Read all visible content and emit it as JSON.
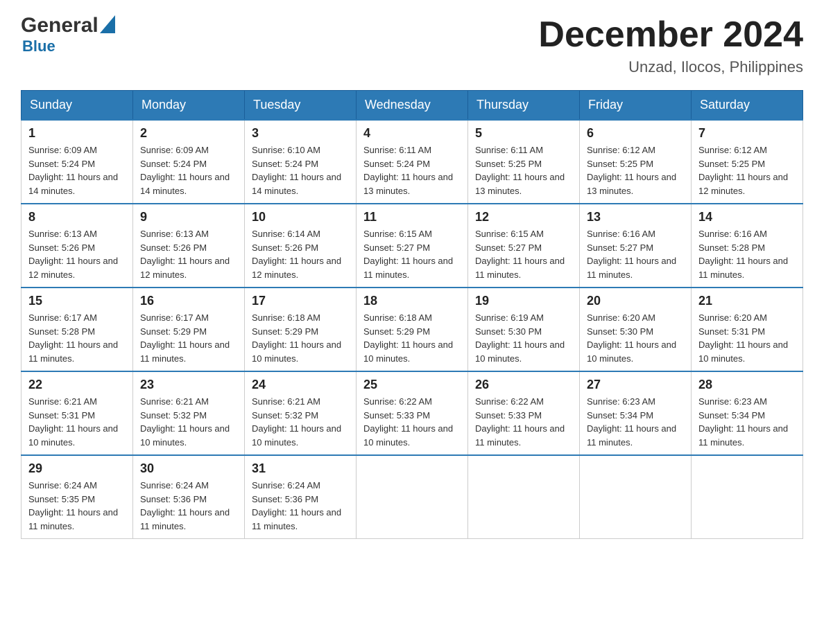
{
  "header": {
    "logo_general": "General",
    "logo_blue": "Blue",
    "main_title": "December 2024",
    "subtitle": "Unzad, Ilocos, Philippines"
  },
  "calendar": {
    "days_of_week": [
      "Sunday",
      "Monday",
      "Tuesday",
      "Wednesday",
      "Thursday",
      "Friday",
      "Saturday"
    ],
    "weeks": [
      [
        {
          "day": "1",
          "sunrise": "6:09 AM",
          "sunset": "5:24 PM",
          "daylight": "11 hours and 14 minutes."
        },
        {
          "day": "2",
          "sunrise": "6:09 AM",
          "sunset": "5:24 PM",
          "daylight": "11 hours and 14 minutes."
        },
        {
          "day": "3",
          "sunrise": "6:10 AM",
          "sunset": "5:24 PM",
          "daylight": "11 hours and 14 minutes."
        },
        {
          "day": "4",
          "sunrise": "6:11 AM",
          "sunset": "5:24 PM",
          "daylight": "11 hours and 13 minutes."
        },
        {
          "day": "5",
          "sunrise": "6:11 AM",
          "sunset": "5:25 PM",
          "daylight": "11 hours and 13 minutes."
        },
        {
          "day": "6",
          "sunrise": "6:12 AM",
          "sunset": "5:25 PM",
          "daylight": "11 hours and 13 minutes."
        },
        {
          "day": "7",
          "sunrise": "6:12 AM",
          "sunset": "5:25 PM",
          "daylight": "11 hours and 12 minutes."
        }
      ],
      [
        {
          "day": "8",
          "sunrise": "6:13 AM",
          "sunset": "5:26 PM",
          "daylight": "11 hours and 12 minutes."
        },
        {
          "day": "9",
          "sunrise": "6:13 AM",
          "sunset": "5:26 PM",
          "daylight": "11 hours and 12 minutes."
        },
        {
          "day": "10",
          "sunrise": "6:14 AM",
          "sunset": "5:26 PM",
          "daylight": "11 hours and 12 minutes."
        },
        {
          "day": "11",
          "sunrise": "6:15 AM",
          "sunset": "5:27 PM",
          "daylight": "11 hours and 11 minutes."
        },
        {
          "day": "12",
          "sunrise": "6:15 AM",
          "sunset": "5:27 PM",
          "daylight": "11 hours and 11 minutes."
        },
        {
          "day": "13",
          "sunrise": "6:16 AM",
          "sunset": "5:27 PM",
          "daylight": "11 hours and 11 minutes."
        },
        {
          "day": "14",
          "sunrise": "6:16 AM",
          "sunset": "5:28 PM",
          "daylight": "11 hours and 11 minutes."
        }
      ],
      [
        {
          "day": "15",
          "sunrise": "6:17 AM",
          "sunset": "5:28 PM",
          "daylight": "11 hours and 11 minutes."
        },
        {
          "day": "16",
          "sunrise": "6:17 AM",
          "sunset": "5:29 PM",
          "daylight": "11 hours and 11 minutes."
        },
        {
          "day": "17",
          "sunrise": "6:18 AM",
          "sunset": "5:29 PM",
          "daylight": "11 hours and 10 minutes."
        },
        {
          "day": "18",
          "sunrise": "6:18 AM",
          "sunset": "5:29 PM",
          "daylight": "11 hours and 10 minutes."
        },
        {
          "day": "19",
          "sunrise": "6:19 AM",
          "sunset": "5:30 PM",
          "daylight": "11 hours and 10 minutes."
        },
        {
          "day": "20",
          "sunrise": "6:20 AM",
          "sunset": "5:30 PM",
          "daylight": "11 hours and 10 minutes."
        },
        {
          "day": "21",
          "sunrise": "6:20 AM",
          "sunset": "5:31 PM",
          "daylight": "11 hours and 10 minutes."
        }
      ],
      [
        {
          "day": "22",
          "sunrise": "6:21 AM",
          "sunset": "5:31 PM",
          "daylight": "11 hours and 10 minutes."
        },
        {
          "day": "23",
          "sunrise": "6:21 AM",
          "sunset": "5:32 PM",
          "daylight": "11 hours and 10 minutes."
        },
        {
          "day": "24",
          "sunrise": "6:21 AM",
          "sunset": "5:32 PM",
          "daylight": "11 hours and 10 minutes."
        },
        {
          "day": "25",
          "sunrise": "6:22 AM",
          "sunset": "5:33 PM",
          "daylight": "11 hours and 10 minutes."
        },
        {
          "day": "26",
          "sunrise": "6:22 AM",
          "sunset": "5:33 PM",
          "daylight": "11 hours and 11 minutes."
        },
        {
          "day": "27",
          "sunrise": "6:23 AM",
          "sunset": "5:34 PM",
          "daylight": "11 hours and 11 minutes."
        },
        {
          "day": "28",
          "sunrise": "6:23 AM",
          "sunset": "5:34 PM",
          "daylight": "11 hours and 11 minutes."
        }
      ],
      [
        {
          "day": "29",
          "sunrise": "6:24 AM",
          "sunset": "5:35 PM",
          "daylight": "11 hours and 11 minutes."
        },
        {
          "day": "30",
          "sunrise": "6:24 AM",
          "sunset": "5:36 PM",
          "daylight": "11 hours and 11 minutes."
        },
        {
          "day": "31",
          "sunrise": "6:24 AM",
          "sunset": "5:36 PM",
          "daylight": "11 hours and 11 minutes."
        },
        null,
        null,
        null,
        null
      ]
    ]
  }
}
